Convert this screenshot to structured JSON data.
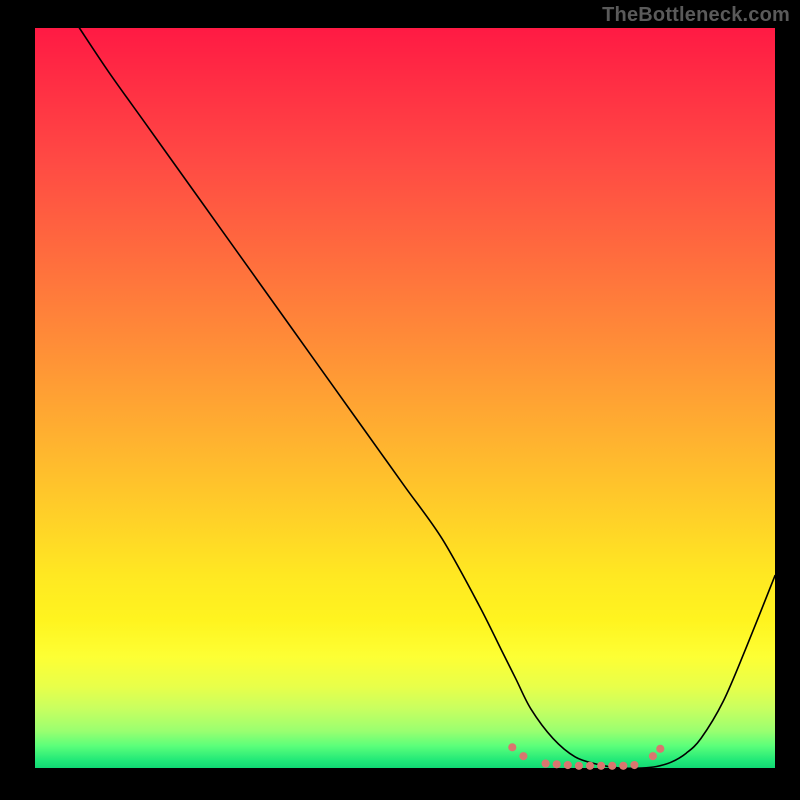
{
  "watermark": "TheBottleneck.com",
  "chart_data": {
    "type": "line",
    "title": "",
    "xlabel": "",
    "ylabel": "",
    "xlim": [
      0,
      100
    ],
    "ylim": [
      0,
      100
    ],
    "series": [
      {
        "name": "curve",
        "x": [
          6,
          10,
          15,
          20,
          25,
          30,
          35,
          40,
          45,
          50,
          55,
          60,
          63,
          65,
          67,
          70,
          73,
          76,
          79,
          82,
          84,
          86,
          88,
          90,
          93,
          96,
          100
        ],
        "y": [
          100,
          94,
          87,
          80,
          73,
          66,
          59,
          52,
          45,
          38,
          31,
          22,
          16,
          12,
          8,
          4,
          1.5,
          0.5,
          0,
          0,
          0.2,
          0.8,
          2,
          4,
          9,
          16,
          26
        ]
      }
    ],
    "markers": {
      "name": "bottom-dots",
      "color": "#d9766f",
      "points": [
        {
          "x": 64.5,
          "y": 2.8
        },
        {
          "x": 66.0,
          "y": 1.6
        },
        {
          "x": 69.0,
          "y": 0.6
        },
        {
          "x": 70.5,
          "y": 0.5
        },
        {
          "x": 72.0,
          "y": 0.4
        },
        {
          "x": 73.5,
          "y": 0.3
        },
        {
          "x": 75.0,
          "y": 0.3
        },
        {
          "x": 76.5,
          "y": 0.3
        },
        {
          "x": 78.0,
          "y": 0.3
        },
        {
          "x": 79.5,
          "y": 0.3
        },
        {
          "x": 81.0,
          "y": 0.4
        },
        {
          "x": 83.5,
          "y": 1.6
        },
        {
          "x": 84.5,
          "y": 2.6
        }
      ]
    },
    "gradient_stops": [
      {
        "pos": 0,
        "color": "#ff1a44"
      },
      {
        "pos": 50,
        "color": "#ff9a34"
      },
      {
        "pos": 80,
        "color": "#fff41f"
      },
      {
        "pos": 100,
        "color": "#10d874"
      }
    ]
  }
}
